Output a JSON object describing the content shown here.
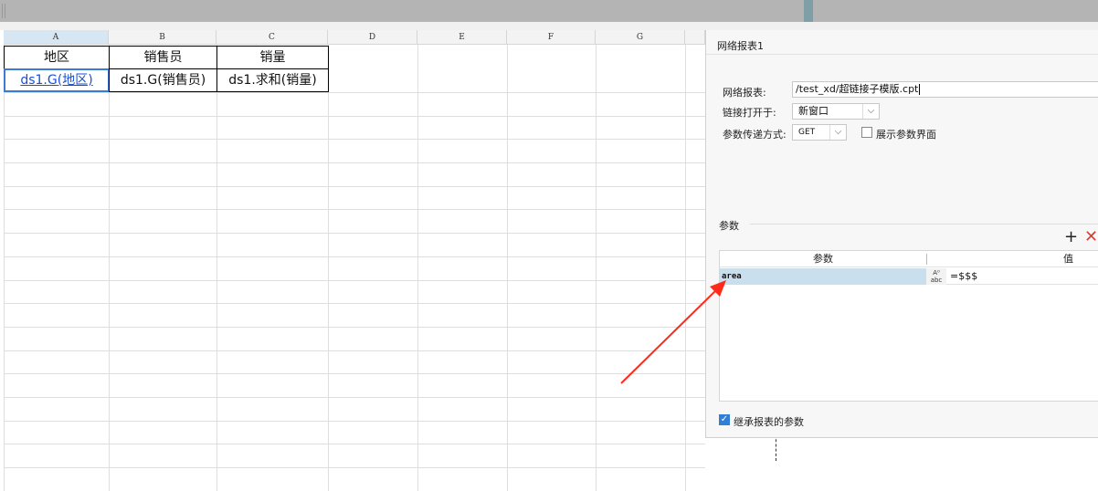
{
  "columns": [
    "A",
    "B",
    "C",
    "D",
    "E",
    "F",
    "G"
  ],
  "header_row": [
    "地区",
    "销售员",
    "销量"
  ],
  "data_row": [
    "ds1.G(地区)",
    "ds1.G(销售员)",
    "ds1.求和(销量)"
  ],
  "dialog": {
    "title": "网络报表1",
    "report_label": "网络报表:",
    "report_value": "/test_xd/超链接子模版.cpt",
    "open_label": "链接打开于:",
    "open_value": "新窗口",
    "method_label": "参数传递方式:",
    "method_value": "GET",
    "show_param_label": "展示参数界面",
    "params_group_label": "参数",
    "add_icon": "plus-icon",
    "delete_icon": "close-icon",
    "table": {
      "col_param": "参数",
      "col_value": "值",
      "rows": [
        {
          "name": "area",
          "type_top": "A⁰",
          "type_bottom": "abc",
          "value": "=$$$"
        }
      ]
    },
    "inherit_label": "继承报表的参数",
    "inherit_checked": true
  },
  "colors": {
    "accent": "#3a7bd5",
    "link": "#1c4fd6",
    "arrow": "#ff2a1a",
    "delete": "#e23b2e"
  }
}
